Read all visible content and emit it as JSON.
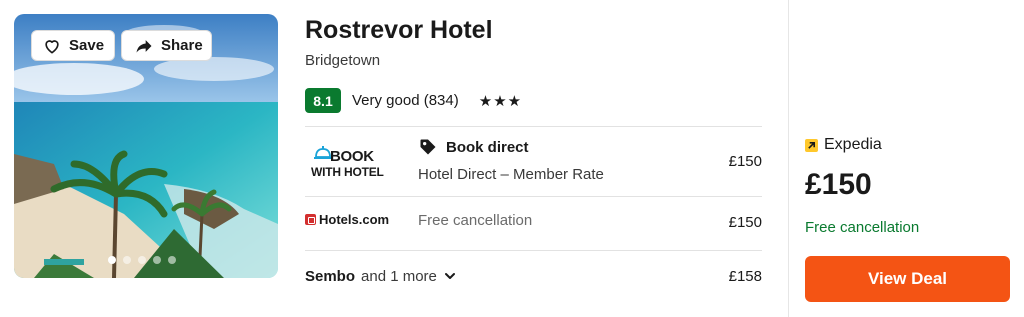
{
  "photo": {
    "save_label": "Save",
    "share_label": "Share",
    "carousel_dots": 5,
    "active_dot": 0
  },
  "hotel": {
    "name": "Rostrevor Hotel",
    "location": "Bridgetown",
    "score": "8.1",
    "rating_text": "Very good (834)",
    "stars": "★★★"
  },
  "offers": [
    {
      "provider_logo_line1": "BOOK",
      "provider_logo_line2": "WITH HOTEL",
      "tag": "Book direct",
      "detail": "Hotel Direct – Member Rate",
      "price": "£150"
    },
    {
      "provider_logo": "Hotels.com",
      "detail": "Free cancellation",
      "price": "£150"
    },
    {
      "provider": "Sembo",
      "more": "and 1 more",
      "price": "£158"
    }
  ],
  "deal": {
    "provider": "Expedia",
    "price": "£150",
    "cancellation": "Free cancellation",
    "button_label": "View Deal",
    "colors": {
      "button": "#f45414",
      "cancel": "#0a7a2f",
      "score_badge": "#0a7a2f"
    }
  }
}
